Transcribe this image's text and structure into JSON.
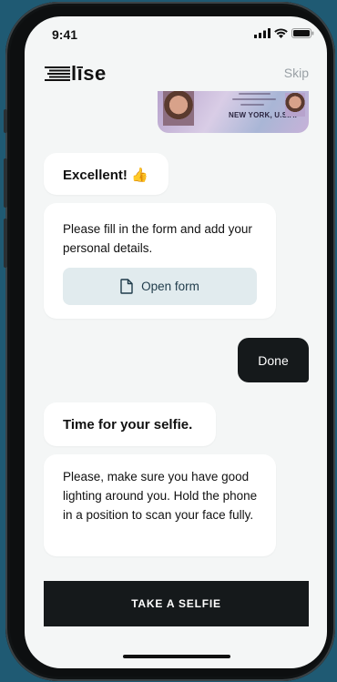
{
  "status_bar": {
    "time": "9:41"
  },
  "header": {
    "logo_text": "līse",
    "skip_label": "Skip"
  },
  "id_card": {
    "state_text": "NEW YORK, U.S.A."
  },
  "messages": {
    "excellent": "Excellent! 👍",
    "form_text": "Please fill in the form and add your personal details.",
    "open_form_label": "Open form",
    "done": "Done",
    "selfie_title": "Time for your selfie.",
    "lighting_text": "Please, make sure you have good lighting around you. Hold the phone in a position to scan your face fully."
  },
  "cta": {
    "label": "TAKE A SELFIE"
  },
  "colors": {
    "dark": "#15191b",
    "screen_bg": "#f4f6f6",
    "button_tint": "#e1ebee",
    "outer_bg": "#1f5a73"
  }
}
